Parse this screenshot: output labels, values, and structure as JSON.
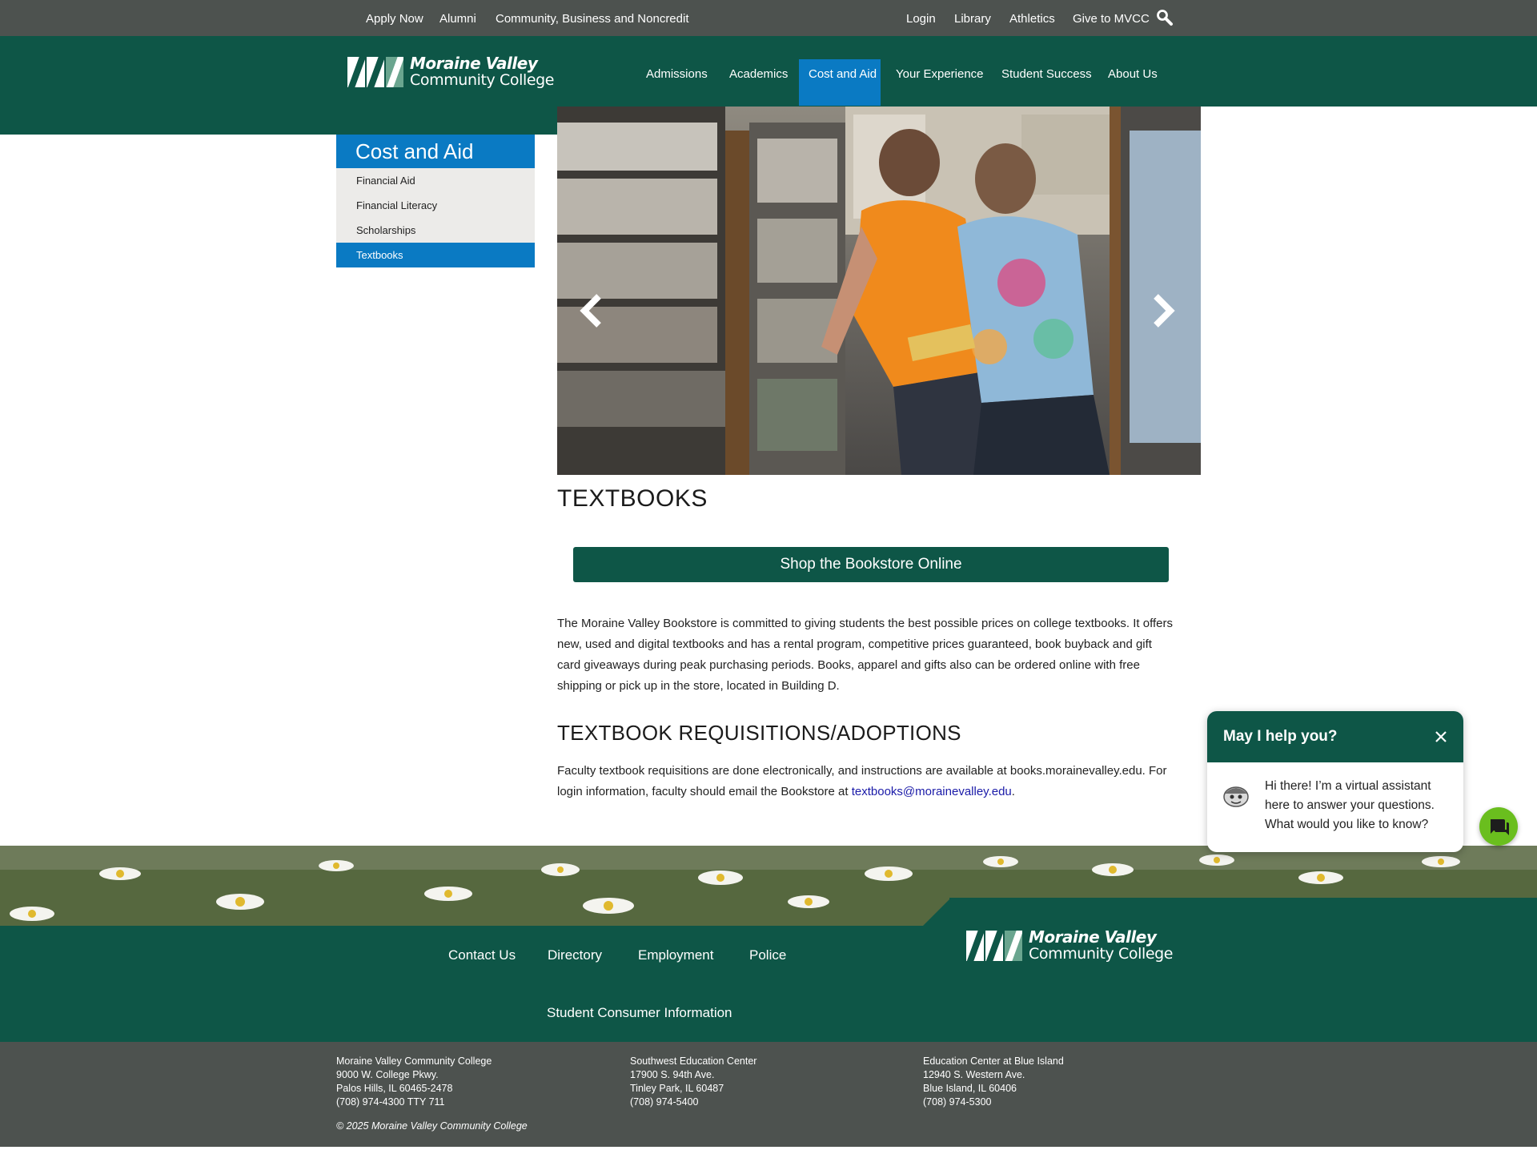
{
  "utility_nav": {
    "items": [
      "Apply Now",
      "Alumni",
      "Community, Business and Noncredit",
      "Login",
      "Library",
      "Athletics",
      "Give to MVCC"
    ]
  },
  "logo": {
    "line1": "Moraine Valley",
    "line2": "Community College"
  },
  "main_nav": {
    "items": [
      "Admissions",
      "Academics",
      "Cost and Aid",
      "Your Experience",
      "Student Success",
      "About Us"
    ],
    "active": "Cost and Aid"
  },
  "sidebar": {
    "title": "Cost and Aid",
    "items": [
      "Financial Aid",
      "Financial Literacy",
      "Scholarships",
      "Textbooks"
    ],
    "active": "Textbooks"
  },
  "main": {
    "title": "TEXTBOOKS",
    "shop_button": "Shop the Bookstore Online",
    "intro": "The Moraine Valley Bookstore is committed to giving students the best possible prices on college textbooks. It offers new, used and digital textbooks and has a rental program, competitive prices guaranteed, book buyback and gift card giveaways during peak purchasing periods. Books, apparel and gifts also can be ordered online with free shipping or pick up in the store, located in Building D.",
    "section_heading": "TEXTBOOK REQUISITIONS/ADOPTIONS",
    "requisitions_text": "Faculty textbook requisitions are done electronically, and instructions are available at books.morainevalley.edu. For login information, faculty should email the Bookstore at ",
    "email": "textbooks@morainevalley.edu",
    "after_email": "."
  },
  "footer": {
    "links": [
      "Contact Us",
      "Directory",
      "Employment",
      "Police",
      "Student Consumer Information"
    ],
    "addresses": [
      {
        "name": "Moraine Valley Community College",
        "street": "9000 W. College Pkwy.",
        "city": "Palos Hills, IL 60465-2478",
        "phone": "(708) 974-4300 TTY 711"
      },
      {
        "name": "Southwest Education Center",
        "street": "17900 S. 94th Ave.",
        "city": "Tinley Park, IL 60487",
        "phone": "(708) 974-5400"
      },
      {
        "name": "Education Center at Blue Island",
        "street": "12940 S. Western Ave.",
        "city": "Blue Island, IL 60406",
        "phone": "(708) 974-5300"
      }
    ],
    "copyright": "© 2025 Moraine Valley Community College"
  },
  "chat": {
    "title": "May I help you?",
    "message": "Hi there! I’m a virtual assistant here to answer your questions. What would you like to know?"
  },
  "colors": {
    "brand_green": "#0e5647",
    "utility_gray": "#4d524f",
    "accent_blue": "#0a7ac3",
    "chat_launcher_green": "#6abe1e",
    "link_blue": "#1a1aa8"
  },
  "icons": [
    "search-icon",
    "arrow-left-icon",
    "arrow-right-icon",
    "close-icon",
    "chat-bubble-icon",
    "assistant-avatar-icon"
  ]
}
